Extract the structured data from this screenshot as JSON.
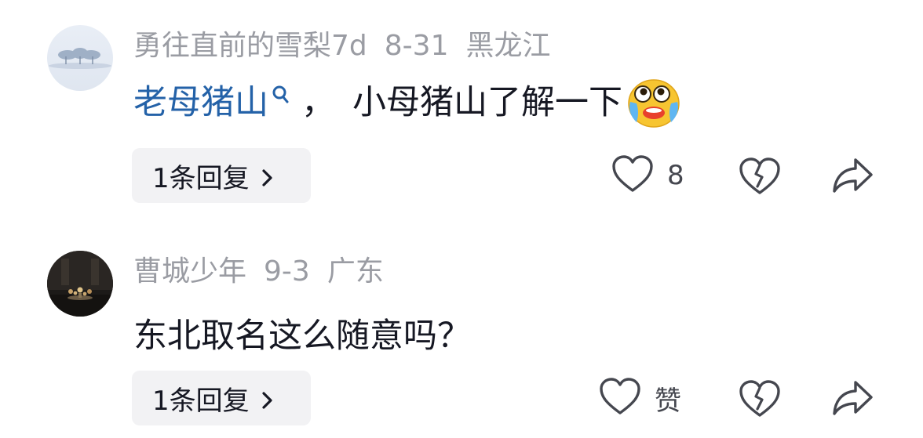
{
  "comments": [
    {
      "username": "勇往直前的雪梨",
      "age": "7d",
      "date": "8-31",
      "location": "黑龙江",
      "linked_text": "老母猪山",
      "separator": "，",
      "text": "小母猪山了解一下",
      "emoji_icon": "crying-laughing-emoji",
      "reply_label": "1条回复",
      "like_count": "8"
    },
    {
      "username": "曹城少年",
      "date": "9-3",
      "location": "广东",
      "text": "东北取名这么随意吗？",
      "reply_label": "1条回复",
      "like_label": "赞"
    }
  ],
  "icons": {
    "like": "heart-outline-icon",
    "dislike": "broken-heart-icon",
    "share": "share-arrow-icon",
    "link": "search-link-icon",
    "chevron": "chevron-right-icon"
  },
  "colors": {
    "link": "#2462a8",
    "meta": "#9a9ca3",
    "text": "#161823",
    "reply_bg": "#f2f2f4"
  }
}
